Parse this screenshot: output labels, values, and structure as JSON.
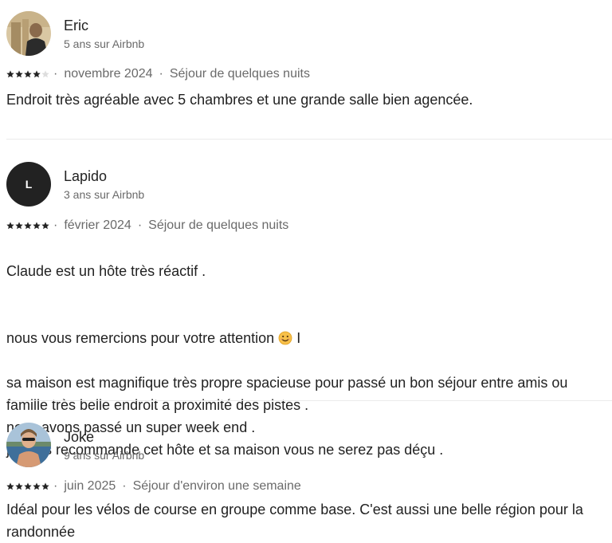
{
  "reviews": [
    {
      "name": "Eric",
      "tenure": "5 ans sur Airbnb",
      "rating": 4,
      "date": "novembre 2024",
      "stay": "Séjour de quelques nuits",
      "text": "Endroit très agréable avec 5 chambres et une grande salle bien agencée."
    },
    {
      "name": "Lapido",
      "initial": "L",
      "tenure": "3 ans sur Airbnb",
      "rating": 5,
      "date": "février 2024",
      "stay": "Séjour de quelques nuits",
      "text_line1": "Claude est un hôte très réactif .",
      "text_line2_before_emoji": "nous vous remercions pour votre attention ",
      "text_line2_after_emoji": " I",
      "text_rest": "sa maison est magnifique très propre spacieuse pour passé un bon séjour entre amis ou famille très belle endroit a proximité des pistes .\nnous avons passé un super week end .\nje vous recommande cet hôte et sa maison vous ne serez pas déçu ."
    },
    {
      "name": "Joke",
      "tenure": "9 ans sur Airbnb",
      "rating": 5,
      "date": "juin 2025",
      "stay": "Séjour d'environ une semaine",
      "text": "Idéal pour les vélos de course en groupe comme base. C'est aussi une belle région pour la randonnée"
    }
  ],
  "separator": "·",
  "icons": {
    "star": "star-icon",
    "emoji": "smiling-face-emoji"
  },
  "colors": {
    "text": "#222222",
    "secondary": "#6a6a6a",
    "divider": "#ebebeb",
    "star_filled": "#222222",
    "star_empty": "#dddddd"
  }
}
